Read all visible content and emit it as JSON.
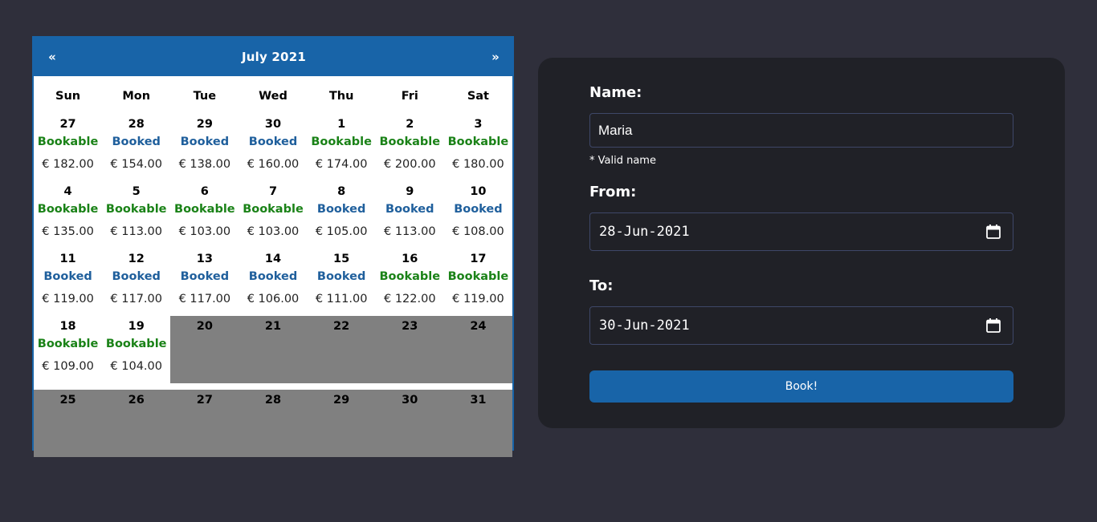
{
  "calendar": {
    "title": "July 2021",
    "prev_label": "«",
    "next_label": "»",
    "weekdays": [
      "Sun",
      "Mon",
      "Tue",
      "Wed",
      "Thu",
      "Fri",
      "Sat"
    ],
    "weeks": [
      [
        {
          "day": "27",
          "status": "Bookable",
          "price": "€ 182.00"
        },
        {
          "day": "28",
          "status": "Booked",
          "price": "€ 154.00"
        },
        {
          "day": "29",
          "status": "Booked",
          "price": "€ 138.00"
        },
        {
          "day": "30",
          "status": "Booked",
          "price": "€ 160.00"
        },
        {
          "day": "1",
          "status": "Bookable",
          "price": "€ 174.00"
        },
        {
          "day": "2",
          "status": "Bookable",
          "price": "€ 200.00"
        },
        {
          "day": "3",
          "status": "Bookable",
          "price": "€ 180.00"
        }
      ],
      [
        {
          "day": "4",
          "status": "Bookable",
          "price": "€ 135.00"
        },
        {
          "day": "5",
          "status": "Bookable",
          "price": "€ 113.00"
        },
        {
          "day": "6",
          "status": "Bookable",
          "price": "€ 103.00"
        },
        {
          "day": "7",
          "status": "Bookable",
          "price": "€ 103.00"
        },
        {
          "day": "8",
          "status": "Booked",
          "price": "€ 105.00"
        },
        {
          "day": "9",
          "status": "Booked",
          "price": "€ 113.00"
        },
        {
          "day": "10",
          "status": "Booked",
          "price": "€ 108.00"
        }
      ],
      [
        {
          "day": "11",
          "status": "Booked",
          "price": "€ 119.00"
        },
        {
          "day": "12",
          "status": "Booked",
          "price": "€ 117.00"
        },
        {
          "day": "13",
          "status": "Booked",
          "price": "€ 117.00"
        },
        {
          "day": "14",
          "status": "Booked",
          "price": "€ 106.00"
        },
        {
          "day": "15",
          "status": "Booked",
          "price": "€ 111.00"
        },
        {
          "day": "16",
          "status": "Bookable",
          "price": "€ 122.00"
        },
        {
          "day": "17",
          "status": "Bookable",
          "price": "€ 119.00"
        }
      ],
      [
        {
          "day": "18",
          "status": "Bookable",
          "price": "€ 109.00"
        },
        {
          "day": "19",
          "status": "Bookable",
          "price": "€ 104.00"
        },
        {
          "day": "20",
          "disabled": true
        },
        {
          "day": "21",
          "disabled": true
        },
        {
          "day": "22",
          "disabled": true
        },
        {
          "day": "23",
          "disabled": true
        },
        {
          "day": "24",
          "disabled": true
        }
      ],
      [
        {
          "day": "25",
          "disabled": true
        },
        {
          "day": "26",
          "disabled": true
        },
        {
          "day": "27",
          "disabled": true
        },
        {
          "day": "28",
          "disabled": true
        },
        {
          "day": "29",
          "disabled": true
        },
        {
          "day": "30",
          "disabled": true
        },
        {
          "day": "31",
          "disabled": true
        }
      ]
    ]
  },
  "colors": {
    "accent": "#1864a8",
    "bookable": "#1a8217",
    "booked": "#1f5f9c",
    "disabled": "#808080",
    "background": "#2f2f3b",
    "card": "#202127"
  },
  "form": {
    "name_label": "Name:",
    "name_value": "Maria",
    "name_note": "* Valid name",
    "from_label": "From:",
    "from_value": "28-Jun-2021",
    "to_label": "To:",
    "to_value": "30-Jun-2021",
    "date_icon": "calendar-icon",
    "submit_label": "Book!"
  }
}
